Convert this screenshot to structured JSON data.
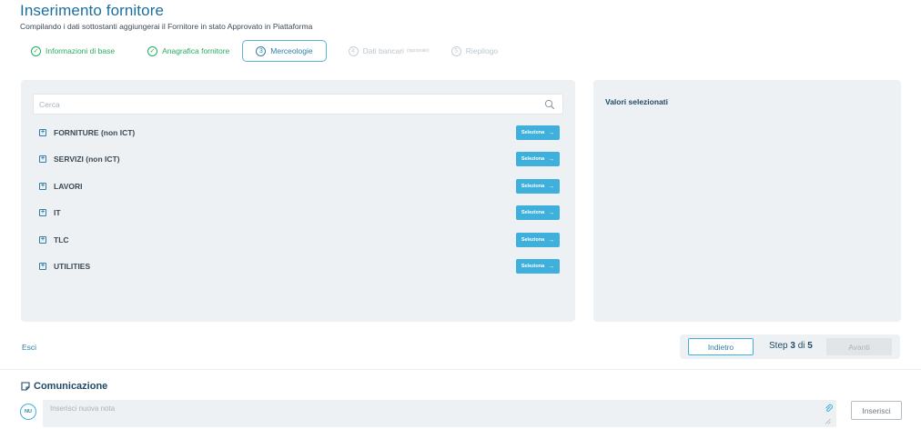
{
  "header": {
    "title": "Inserimento fornitore",
    "subtitle": "Compilando i dati sottostanti aggiungerai il Fornitore in stato Approvato in Piattaforma"
  },
  "stepper": {
    "steps": [
      {
        "num": "✓",
        "label": "Informazioni di base",
        "state": "done"
      },
      {
        "num": "✓",
        "label": "Anagrafica fornitore",
        "state": "done"
      },
      {
        "num": "3",
        "label": "Merceologie",
        "state": "active"
      },
      {
        "num": "4",
        "label": "Dati bancari",
        "hint": "(opzionale)",
        "state": "disabled"
      },
      {
        "num": "5",
        "label": "Riepilogo",
        "state": "disabled"
      }
    ]
  },
  "search": {
    "placeholder": "Cerca",
    "icon": "search-icon"
  },
  "categories": {
    "select_label": "Seleziona",
    "select_arrow": "→",
    "expand_glyph": "+",
    "items": [
      {
        "label": "FORNITURE (non ICT)"
      },
      {
        "label": "SERVIZI (non ICT)"
      },
      {
        "label": "LAVORI"
      },
      {
        "label": "IT"
      },
      {
        "label": "TLC"
      },
      {
        "label": "UTILITIES"
      }
    ]
  },
  "selected_panel": {
    "title": "Valori selezionati"
  },
  "footer": {
    "exit_label": "Esci",
    "back_label": "Indietro",
    "step_prefix": "Step",
    "step_current": "3",
    "step_of": "di",
    "step_total": "5",
    "next_label": "Avanti"
  },
  "communication": {
    "title": "Comunicazione",
    "avatar_initials": "NU",
    "note_placeholder": "Inserisci nuova nota",
    "submit_label": "Inserisci"
  },
  "colors": {
    "primary": "#1b6fa0",
    "accent": "#3fb0db",
    "success": "#27ae60",
    "panel_bg": "#eef1f3"
  }
}
